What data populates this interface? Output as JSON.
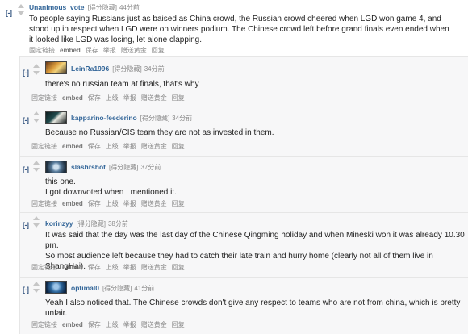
{
  "comments": [
    {
      "toggle": "[-]",
      "author": "Unanimous_vote",
      "score": "[得分隐藏]",
      "time": "44分前",
      "lines": [
        "To people saying Russians just as baised as China crowd, the Russian crowd cheered when LGD won game 4, and",
        "stood up in respect when LGD were on winners podium. The Chinese crowd left before grand finals even ended when",
        "it looked like LGD was losing, let alone clapping."
      ],
      "buttons": [
        "固定链接",
        "embed",
        "保存",
        "举报",
        "赠送黄金",
        "回复"
      ]
    },
    {
      "toggle": "[-]",
      "author": "LeinRa1996",
      "score": "[得分隐藏]",
      "time": "34分前",
      "lines": [
        "there's no russian team at finals, that's why"
      ],
      "buttons": [
        "固定链接",
        "embed",
        "保存",
        "上级",
        "举报",
        "赠送黄金",
        "回复"
      ]
    },
    {
      "toggle": "[-]",
      "author": "kapparino-feederino",
      "score": "[得分隐藏]",
      "time": "34分前",
      "lines": [
        "Because no Russian/CIS team they are not as invested in them."
      ],
      "buttons": [
        "固定链接",
        "embed",
        "保存",
        "上级",
        "举报",
        "赠送黄金",
        "回复"
      ]
    },
    {
      "toggle": "[-]",
      "author": "slashrshot",
      "score": "[得分隐藏]",
      "time": "37分前",
      "lines": [
        "this one.",
        "I got downvoted when I mentioned it."
      ],
      "buttons": [
        "固定链接",
        "embed",
        "保存",
        "上级",
        "举报",
        "赠送黄金",
        "回复"
      ]
    },
    {
      "toggle": "[-]",
      "author": "korinzyy",
      "score": "[得分隐藏]",
      "time": "38分前",
      "lines": [
        "It was said that the day was the last day of the Chinese Qingming holiday and when Mineski won it was already 10.30 pm.",
        "So most audience left because they had to catch their late train and hurry home (clearly not all of them live in",
        "ShangHai)."
      ],
      "buttons": [
        "固定链接",
        "embed",
        "保存",
        "上级",
        "举报",
        "赠送黄金",
        "回复"
      ]
    },
    {
      "toggle": "[-]",
      "author": "optimal0",
      "score": "[得分隐藏]",
      "time": "41分前",
      "lines": [
        "Yeah I also noticed that. The Chinese crowds don't give any respect to teams who are not from china, which is pretty",
        "unfair."
      ],
      "buttons": [
        "固定链接",
        "embed",
        "保存",
        "上级",
        "举报",
        "赠送黄金",
        "回复"
      ]
    }
  ]
}
